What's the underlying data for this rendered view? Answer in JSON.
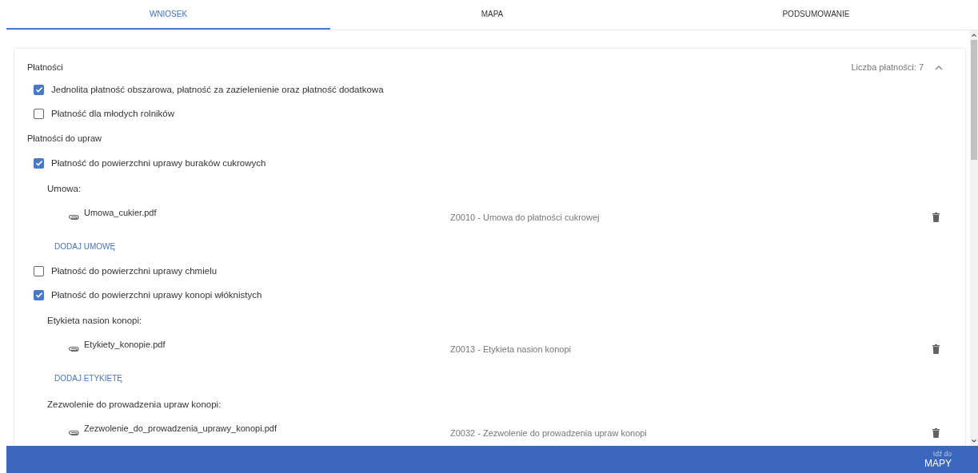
{
  "tabs": [
    {
      "label": "WNIOSEK",
      "selected": true
    },
    {
      "label": "MAPA",
      "selected": false
    },
    {
      "label": "PODSUMOWANIE",
      "selected": false
    }
  ],
  "payments": {
    "title": "Płatności",
    "count_label": "Liczba płatności: 7",
    "expanded": true,
    "items": [
      {
        "kind": "checkbox",
        "label": "Jednolita płatność obszarowa, płatność za zazielenienie oraz płatność dodatkowa",
        "checked": true
      },
      {
        "kind": "checkbox",
        "label": "Płatność dla młodych rolników",
        "checked": false
      },
      {
        "kind": "section",
        "label": "Płatności do upraw"
      },
      {
        "kind": "checkbox",
        "label": "Płatność do powierzchni uprawy buraków cukrowych",
        "checked": true,
        "attachments": [
          {
            "label": "Umowa:",
            "files": [
              {
                "name": "Umowa_cukier.pdf",
                "description": "Z0010 - Umowa do płatności cukrowej"
              }
            ],
            "add_link": "DODAJ UMOWĘ"
          }
        ]
      },
      {
        "kind": "checkbox",
        "label": "Płatność do powierzchni uprawy chmielu",
        "checked": false
      },
      {
        "kind": "checkbox",
        "label": "Płatność do powierzchni uprawy konopi włóknistych",
        "checked": true,
        "attachments": [
          {
            "label": "Etykieta nasion konopi:",
            "files": [
              {
                "name": "Etykiety_konopie.pdf",
                "description": "Z0013 - Etykieta nasion konopi"
              }
            ],
            "add_link": "DODAJ ETYKIETĘ"
          },
          {
            "label": "Zezwolenie do prowadzenia upraw konopi:",
            "files": [
              {
                "name": "Zezwolenie_do_prowadzenia_uprawy_konopi.pdf",
                "description": "Z0032 - Zezwolenie do prowadzenia upraw konopi"
              }
            ]
          }
        ]
      }
    ]
  },
  "bottom_bar": {
    "hint": "Idź do",
    "action": "MAPY"
  }
}
